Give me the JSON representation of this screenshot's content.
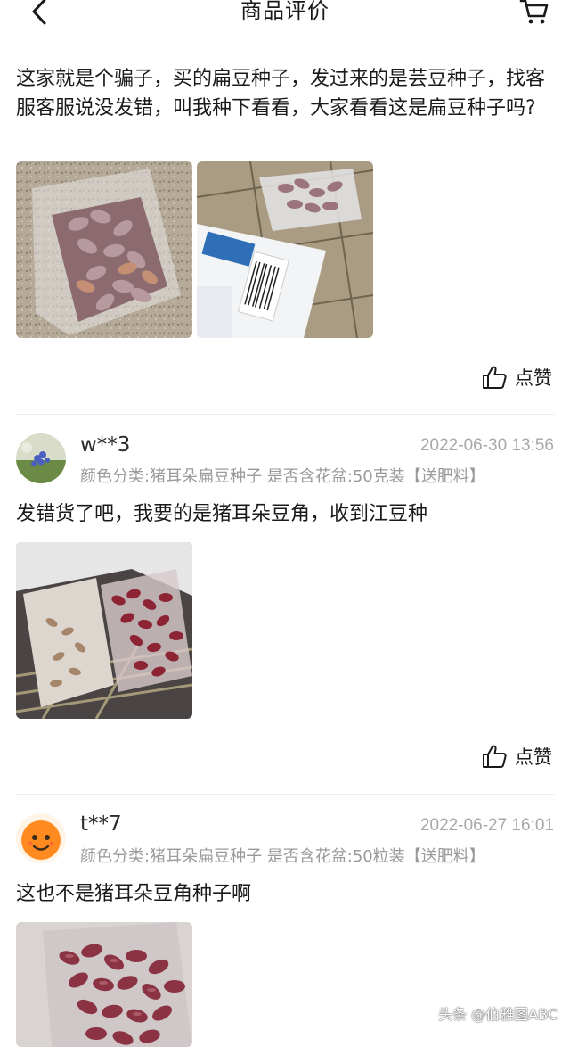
{
  "header": {
    "title": "商品评价",
    "back_icon": "chevron-left-icon",
    "cart_icon": "shopping-cart-icon"
  },
  "reviews": [
    {
      "user": "",
      "date": "",
      "sku": "",
      "text": "这家就是个骗子，买的扁豆种子，发过来的是芸豆种子，找客服客服说没发错，叫我种下看看，大家看看这是扁豆种子吗?",
      "like_label": "点赞"
    },
    {
      "user": "w**3",
      "date": "2022-06-30 13:56",
      "sku": "颜色分类:猪耳朵扁豆种子 是否含花盆:50克装【送肥料】",
      "text": "发错货了吧，我要的是猪耳朵豆角，收到江豆种",
      "like_label": "点赞"
    },
    {
      "user": "t**7",
      "date": "2022-06-27 16:01",
      "sku": "颜色分类:猪耳朵扁豆种子 是否含花盆:50粒装【送肥料】",
      "text": "这也不是猪耳朵豆角种子啊",
      "like_label": ""
    }
  ],
  "watermark": "头条 @伯雅图ABC",
  "colors": {
    "text_primary": "#1a1a1a",
    "text_secondary": "#9a9a9a",
    "date": "#a8a8a8",
    "divider": "#ececec"
  }
}
